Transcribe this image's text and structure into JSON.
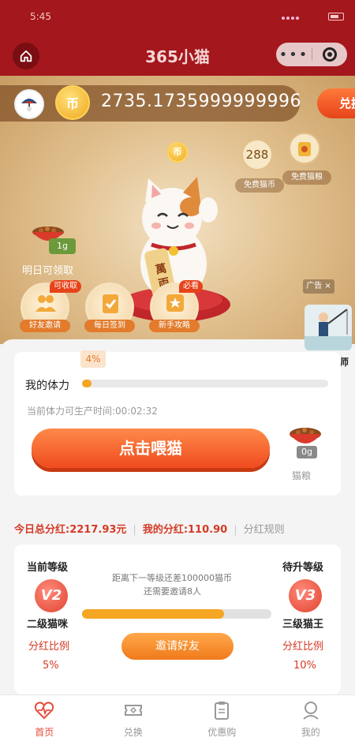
{
  "status": {
    "time": "5:45"
  },
  "nav": {
    "title": "365小猫"
  },
  "hero": {
    "coin_symbol": "币",
    "coins": "2735.1735999999996",
    "exchange_label": "兑换",
    "free_coin_value": "288",
    "free_coin_label": "免费猫币",
    "free_food_label": "免费猫粮",
    "bowl_weight": "1g",
    "tomorrow_label": "明日可领取",
    "ad_tag": "广告 ×",
    "quick_actions": [
      {
        "label": "好友邀请",
        "badge": "可收取"
      },
      {
        "label": "每日签到",
        "badge": ""
      },
      {
        "label": "新手攻略",
        "badge": "必看"
      }
    ],
    "fishing_label": "钓鱼大师"
  },
  "stamina": {
    "percent_label": "4%",
    "percent": 4,
    "label": "我的体力",
    "production_time": "当前体力可生产时间:00:02:32",
    "feed_button": "点击喂猫",
    "food_qty": "0g",
    "food_label": "猫粮"
  },
  "dividend": {
    "today_total": "今日总分红:2217.93元",
    "mine": "我的分红:110.90",
    "rules": "分红规则"
  },
  "level": {
    "current_head": "当前等级",
    "current_badge": "V2",
    "current_name": "二级猫咪",
    "ratio_label": "分红比例",
    "current_ratio": "5%",
    "next_head": "待升等级",
    "next_badge": "V3",
    "next_name": "三级猫王",
    "next_ratio": "10%",
    "gap_line1": "距离下一等级还差100000猫币",
    "gap_line2": "还需要邀请8人",
    "progress": 75,
    "invite_button": "邀请好友"
  },
  "tabs": [
    {
      "label": "首页",
      "active": true
    },
    {
      "label": "兑换",
      "active": false
    },
    {
      "label": "优惠购",
      "active": false
    },
    {
      "label": "我的",
      "active": false
    }
  ],
  "colors": {
    "brand": "#a4171c",
    "accent": "#ef4b1e",
    "progress": "#f5a623"
  }
}
